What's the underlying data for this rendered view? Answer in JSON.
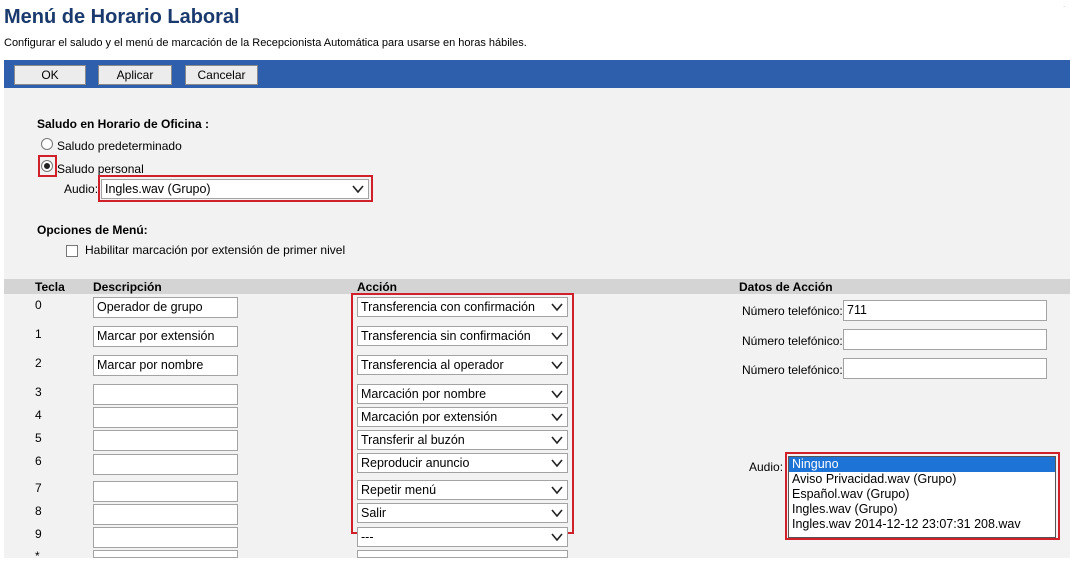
{
  "page": {
    "title": "Menú de Horario Laboral",
    "subtitle": "Configurar el saludo y el menú de marcación de la Recepcionista Automática para usarse en horas hábiles."
  },
  "toolbar": {
    "ok": "OK",
    "apply": "Aplicar",
    "cancel": "Cancelar"
  },
  "greeting": {
    "heading": "Saludo en Horario de Oficina :",
    "default_label": "Saludo predeterminado",
    "personal_label": "Saludo personal",
    "selected": "personal",
    "audio_label": "Audio:",
    "audio_value": "Ingles.wav (Grupo)"
  },
  "menu_options": {
    "heading": "Opciones de Menú:",
    "first_level_label": "Habilitar marcación por extensión de primer nivel",
    "first_level_checked": false
  },
  "table": {
    "headers": {
      "key": "Tecla",
      "description": "Descripción",
      "action": "Acción",
      "action_data": "Datos de Acción"
    },
    "rows": [
      {
        "key": "0",
        "description": "Operador de grupo",
        "action": "Transferencia con confirmación",
        "data_label": "Número telefónico:",
        "data_value": "711"
      },
      {
        "key": "1",
        "description": "Marcar por extensión",
        "action": "Transferencia sin confirmación",
        "data_label": "Número telefónico:",
        "data_value": ""
      },
      {
        "key": "2",
        "description": "Marcar por nombre",
        "action": "Transferencia al operador",
        "data_label": "Número telefónico:",
        "data_value": ""
      },
      {
        "key": "3",
        "description": "",
        "action": "Marcación por nombre"
      },
      {
        "key": "4",
        "description": "",
        "action": "Marcación por extensión"
      },
      {
        "key": "5",
        "description": "",
        "action": "Transferir al buzón"
      },
      {
        "key": "6",
        "description": "",
        "action": "Reproducir anuncio"
      },
      {
        "key": "7",
        "description": "",
        "action": "Repetir menú"
      },
      {
        "key": "8",
        "description": "",
        "action": "Salir"
      },
      {
        "key": "9",
        "description": "",
        "action": "---"
      },
      {
        "key": "*",
        "description": "",
        "action": ""
      }
    ]
  },
  "announcement": {
    "audio_label": "Audio:",
    "options": [
      "Ninguno",
      "Aviso Privacidad.wav (Grupo)",
      "Español.wav (Grupo)",
      "Ingles.wav (Grupo)",
      "Ingles.wav 2014-12-12 23:07:31 208.wav"
    ],
    "selected": "Ninguno"
  },
  "colors": {
    "title": "#1a3a6e",
    "toolbar": "#2d5fad",
    "highlight": "#d0212a",
    "selection": "#1e73d6"
  }
}
